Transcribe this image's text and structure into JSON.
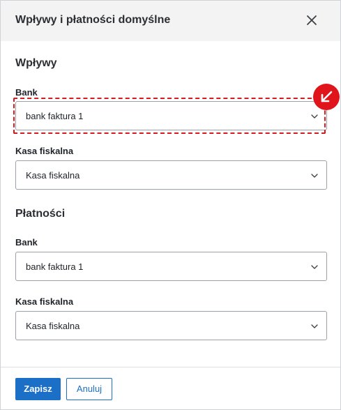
{
  "dialog": {
    "title": "Wpływy i płatności domyślne"
  },
  "inflows": {
    "section_title": "Wpływy",
    "bank_label": "Bank",
    "bank_value": "bank faktura 1",
    "cash_label": "Kasa fiskalna",
    "cash_value": "Kasa fiskalna"
  },
  "payments": {
    "section_title": "Płatności",
    "bank_label": "Bank",
    "bank_value": "bank faktura 1",
    "cash_label": "Kasa fiskalna",
    "cash_value": "Kasa fiskalna"
  },
  "footer": {
    "save_label": "Zapisz",
    "cancel_label": "Anuluj"
  },
  "colors": {
    "accent": "#1c6fc6",
    "highlight": "#d71920",
    "header_bg": "#f3f3f3"
  },
  "icons": {
    "close": "close-icon",
    "chevron": "chevron-down-icon",
    "badge": "arrow-down-left-icon"
  }
}
